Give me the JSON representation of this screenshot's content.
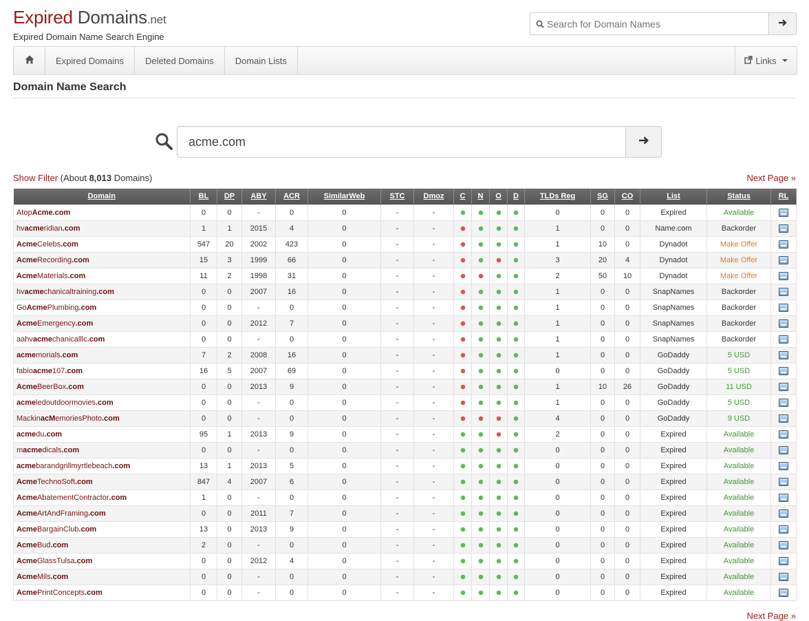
{
  "header": {
    "logo_expired": "Expired",
    "logo_domains": " Domains",
    "logo_tld": ".net",
    "tagline": "Expired Domain Name Search Engine",
    "search_placeholder": "Search for Domain Names"
  },
  "nav": {
    "items": [
      "Expired Domains",
      "Deleted Domains",
      "Domain Lists"
    ],
    "links_label": "Links"
  },
  "page_title": "Domain Name Search",
  "search": {
    "value": "acme.com"
  },
  "filter": {
    "show_filter": "Show Filter",
    "about_prefix": " (About ",
    "count": "8,013",
    "about_suffix": " Domains)"
  },
  "next_page": "Next Page »",
  "table": {
    "columns": [
      "Domain",
      "BL",
      "DP",
      "ABY",
      "ACR",
      "SimilarWeb",
      "STC",
      "Dmoz",
      "C",
      "N",
      "O",
      "D",
      "TLDs Reg",
      "SG",
      "CO",
      "List",
      "Status",
      "RL"
    ],
    "rows": [
      {
        "pre": "Atop",
        "mid": "Acme",
        "post": "",
        "tld": ".com",
        "bl": "0",
        "dp": "0",
        "aby": "-",
        "acr": "0",
        "sw": "0",
        "stc": "-",
        "dmoz": "-",
        "c": "g",
        "n": "g",
        "o": "g",
        "d": "g",
        "tlds": "0",
        "sg": "0",
        "co": "0",
        "list": "Expired",
        "status": "Available",
        "stype": "available"
      },
      {
        "pre": "hv",
        "mid": "acme",
        "post": "ridian",
        "tld": ".com",
        "bl": "1",
        "dp": "1",
        "aby": "2015",
        "acr": "4",
        "sw": "0",
        "stc": "-",
        "dmoz": "-",
        "c": "r",
        "n": "g",
        "o": "g",
        "d": "g",
        "tlds": "1",
        "sg": "0",
        "co": "0",
        "list": "Name.com",
        "status": "Backorder",
        "stype": "plain"
      },
      {
        "pre": "",
        "mid": "Acme",
        "post": "Celebs",
        "tld": ".com",
        "bl": "547",
        "dp": "20",
        "aby": "2002",
        "acr": "423",
        "sw": "0",
        "stc": "-",
        "dmoz": "-",
        "c": "r",
        "n": "g",
        "o": "g",
        "d": "g",
        "tlds": "1",
        "sg": "10",
        "co": "0",
        "list": "Dynadot",
        "status": "Make Offer",
        "stype": "offer"
      },
      {
        "pre": "",
        "mid": "Acme",
        "post": "Recording",
        "tld": ".com",
        "bl": "15",
        "dp": "3",
        "aby": "1999",
        "acr": "66",
        "sw": "0",
        "stc": "-",
        "dmoz": "-",
        "c": "r",
        "n": "g",
        "o": "r",
        "d": "g",
        "tlds": "3",
        "sg": "20",
        "co": "4",
        "list": "Dynadot",
        "status": "Make Offer",
        "stype": "offer"
      },
      {
        "pre": "",
        "mid": "Acme",
        "post": "Materials",
        "tld": ".com",
        "bl": "11",
        "dp": "2",
        "aby": "1998",
        "acr": "31",
        "sw": "0",
        "stc": "-",
        "dmoz": "-",
        "c": "r",
        "n": "r",
        "o": "g",
        "d": "g",
        "tlds": "2",
        "sg": "50",
        "co": "10",
        "list": "Dynadot",
        "status": "Make Offer",
        "stype": "offer"
      },
      {
        "pre": "hv",
        "mid": "acme",
        "post": "chanicaltraining",
        "tld": ".com",
        "bl": "0",
        "dp": "0",
        "aby": "2007",
        "acr": "16",
        "sw": "0",
        "stc": "-",
        "dmoz": "-",
        "c": "r",
        "n": "g",
        "o": "g",
        "d": "g",
        "tlds": "1",
        "sg": "0",
        "co": "0",
        "list": "SnapNames",
        "status": "Backorder",
        "stype": "plain"
      },
      {
        "pre": "Go",
        "mid": "Acme",
        "post": "Plumbing",
        "tld": ".com",
        "bl": "0",
        "dp": "0",
        "aby": "-",
        "acr": "0",
        "sw": "0",
        "stc": "-",
        "dmoz": "-",
        "c": "r",
        "n": "g",
        "o": "g",
        "d": "g",
        "tlds": "1",
        "sg": "0",
        "co": "0",
        "list": "SnapNames",
        "status": "Backorder",
        "stype": "plain"
      },
      {
        "pre": "",
        "mid": "Acme",
        "post": "Emergency",
        "tld": ".com",
        "bl": "0",
        "dp": "0",
        "aby": "2012",
        "acr": "7",
        "sw": "0",
        "stc": "-",
        "dmoz": "-",
        "c": "r",
        "n": "g",
        "o": "g",
        "d": "g",
        "tlds": "1",
        "sg": "0",
        "co": "0",
        "list": "SnapNames",
        "status": "Backorder",
        "stype": "plain"
      },
      {
        "pre": "aahv",
        "mid": "acme",
        "post": "chanicalllc",
        "tld": ".com",
        "bl": "0",
        "dp": "0",
        "aby": "-",
        "acr": "0",
        "sw": "0",
        "stc": "-",
        "dmoz": "-",
        "c": "r",
        "n": "g",
        "o": "g",
        "d": "g",
        "tlds": "1",
        "sg": "0",
        "co": "0",
        "list": "SnapNames",
        "status": "Backorder",
        "stype": "plain"
      },
      {
        "pre": "",
        "mid": "acme",
        "post": "morials",
        "tld": ".com",
        "bl": "7",
        "dp": "2",
        "aby": "2008",
        "acr": "16",
        "sw": "0",
        "stc": "-",
        "dmoz": "-",
        "c": "r",
        "n": "g",
        "o": "g",
        "d": "g",
        "tlds": "1",
        "sg": "0",
        "co": "0",
        "list": "GoDaddy",
        "status": "5 USD",
        "stype": "usd"
      },
      {
        "pre": "fabio",
        "mid": "acme",
        "post": "107",
        "tld": ".com",
        "bl": "16",
        "dp": "5",
        "aby": "2007",
        "acr": "69",
        "sw": "0",
        "stc": "-",
        "dmoz": "-",
        "c": "r",
        "n": "g",
        "o": "g",
        "d": "g",
        "tlds": "0",
        "sg": "0",
        "co": "0",
        "list": "GoDaddy",
        "status": "5 USD",
        "stype": "usd"
      },
      {
        "pre": "",
        "mid": "Acme",
        "post": "BeerBox",
        "tld": ".com",
        "bl": "0",
        "dp": "0",
        "aby": "2013",
        "acr": "9",
        "sw": "0",
        "stc": "-",
        "dmoz": "-",
        "c": "r",
        "n": "g",
        "o": "g",
        "d": "g",
        "tlds": "1",
        "sg": "10",
        "co": "26",
        "list": "GoDaddy",
        "status": "11 USD",
        "stype": "usd"
      },
      {
        "pre": "",
        "mid": "acme",
        "post": "ledoutdoormovies",
        "tld": ".com",
        "bl": "0",
        "dp": "0",
        "aby": "-",
        "acr": "0",
        "sw": "0",
        "stc": "-",
        "dmoz": "-",
        "c": "r",
        "n": "g",
        "o": "g",
        "d": "g",
        "tlds": "1",
        "sg": "0",
        "co": "0",
        "list": "GoDaddy",
        "status": "5 USD",
        "stype": "usd"
      },
      {
        "pre": "Mackin",
        "mid": "acM",
        "post": "emoriesPhoto",
        "tld": ".com",
        "bl": "0",
        "dp": "0",
        "aby": "-",
        "acr": "0",
        "sw": "0",
        "stc": "-",
        "dmoz": "-",
        "c": "r",
        "n": "r",
        "o": "r",
        "d": "g",
        "tlds": "4",
        "sg": "0",
        "co": "0",
        "list": "GoDaddy",
        "status": "9 USD",
        "stype": "usd"
      },
      {
        "pre": "",
        "mid": "acme",
        "post": "du",
        "tld": ".com",
        "bl": "95",
        "dp": "1",
        "aby": "2013",
        "acr": "9",
        "sw": "0",
        "stc": "-",
        "dmoz": "-",
        "c": "g",
        "n": "g",
        "o": "r",
        "d": "g",
        "tlds": "2",
        "sg": "0",
        "co": "0",
        "list": "Expired",
        "status": "Available",
        "stype": "available"
      },
      {
        "pre": "m",
        "mid": "acme",
        "post": "dicals",
        "tld": ".com",
        "bl": "0",
        "dp": "0",
        "aby": "-",
        "acr": "0",
        "sw": "0",
        "stc": "-",
        "dmoz": "-",
        "c": "g",
        "n": "g",
        "o": "g",
        "d": "g",
        "tlds": "0",
        "sg": "0",
        "co": "0",
        "list": "Expired",
        "status": "Available",
        "stype": "available"
      },
      {
        "pre": "",
        "mid": "acme",
        "post": "barandgrillmyrtlebeach",
        "tld": ".com",
        "bl": "13",
        "dp": "1",
        "aby": "2013",
        "acr": "5",
        "sw": "0",
        "stc": "-",
        "dmoz": "-",
        "c": "g",
        "n": "g",
        "o": "g",
        "d": "g",
        "tlds": "0",
        "sg": "0",
        "co": "0",
        "list": "Expired",
        "status": "Available",
        "stype": "available"
      },
      {
        "pre": "",
        "mid": "Acme",
        "post": "TechnoSoft",
        "tld": ".com",
        "bl": "847",
        "dp": "4",
        "aby": "2007",
        "acr": "6",
        "sw": "0",
        "stc": "-",
        "dmoz": "-",
        "c": "g",
        "n": "g",
        "o": "g",
        "d": "g",
        "tlds": "0",
        "sg": "0",
        "co": "0",
        "list": "Expired",
        "status": "Available",
        "stype": "available"
      },
      {
        "pre": "",
        "mid": "Acme",
        "post": "AbatementContractor",
        "tld": ".com",
        "bl": "1",
        "dp": "0",
        "aby": "-",
        "acr": "0",
        "sw": "0",
        "stc": "-",
        "dmoz": "-",
        "c": "g",
        "n": "g",
        "o": "g",
        "d": "g",
        "tlds": "0",
        "sg": "0",
        "co": "0",
        "list": "Expired",
        "status": "Available",
        "stype": "available"
      },
      {
        "pre": "",
        "mid": "Acme",
        "post": "ArtAndFraming",
        "tld": ".com",
        "bl": "0",
        "dp": "0",
        "aby": "2011",
        "acr": "7",
        "sw": "0",
        "stc": "-",
        "dmoz": "-",
        "c": "g",
        "n": "g",
        "o": "g",
        "d": "g",
        "tlds": "0",
        "sg": "0",
        "co": "0",
        "list": "Expired",
        "status": "Available",
        "stype": "available"
      },
      {
        "pre": "",
        "mid": "Acme",
        "post": "BargainClub",
        "tld": ".com",
        "bl": "13",
        "dp": "0",
        "aby": "2013",
        "acr": "9",
        "sw": "0",
        "stc": "-",
        "dmoz": "-",
        "c": "g",
        "n": "g",
        "o": "g",
        "d": "g",
        "tlds": "0",
        "sg": "0",
        "co": "0",
        "list": "Expired",
        "status": "Available",
        "stype": "available"
      },
      {
        "pre": "",
        "mid": "Acme",
        "post": "Bud",
        "tld": ".com",
        "bl": "2",
        "dp": "0",
        "aby": "-",
        "acr": "0",
        "sw": "0",
        "stc": "-",
        "dmoz": "-",
        "c": "g",
        "n": "g",
        "o": "g",
        "d": "g",
        "tlds": "0",
        "sg": "0",
        "co": "0",
        "list": "Expired",
        "status": "Available",
        "stype": "available"
      },
      {
        "pre": "",
        "mid": "Acme",
        "post": "GlassTulsa",
        "tld": ".com",
        "bl": "0",
        "dp": "0",
        "aby": "2012",
        "acr": "4",
        "sw": "0",
        "stc": "-",
        "dmoz": "-",
        "c": "g",
        "n": "g",
        "o": "g",
        "d": "g",
        "tlds": "0",
        "sg": "0",
        "co": "0",
        "list": "Expired",
        "status": "Available",
        "stype": "available"
      },
      {
        "pre": "",
        "mid": "Acme",
        "post": "Mils",
        "tld": ".com",
        "bl": "0",
        "dp": "0",
        "aby": "-",
        "acr": "0",
        "sw": "0",
        "stc": "-",
        "dmoz": "-",
        "c": "g",
        "n": "g",
        "o": "g",
        "d": "g",
        "tlds": "0",
        "sg": "0",
        "co": "0",
        "list": "Expired",
        "status": "Available",
        "stype": "available"
      },
      {
        "pre": "",
        "mid": "Acme",
        "post": "PrintConcepts",
        "tld": ".com",
        "bl": "0",
        "dp": "0",
        "aby": "-",
        "acr": "0",
        "sw": "0",
        "stc": "-",
        "dmoz": "-",
        "c": "g",
        "n": "g",
        "o": "g",
        "d": "g",
        "tlds": "0",
        "sg": "0",
        "co": "0",
        "list": "Expired",
        "status": "Available",
        "stype": "available"
      }
    ]
  },
  "icons": {
    "home": "home-icon",
    "search": "search-icon",
    "arrow": "arrow-right-icon",
    "links": "external-link-icon",
    "rl": "reverse-lookup-icon"
  },
  "colors": {
    "brand": "#9b1a1a",
    "available": "#3d9a2f",
    "offer": "#e07d1c",
    "dot_green": "#5cb85c",
    "dot_red": "#e0514f",
    "header_bg": "#5f5f5f"
  }
}
